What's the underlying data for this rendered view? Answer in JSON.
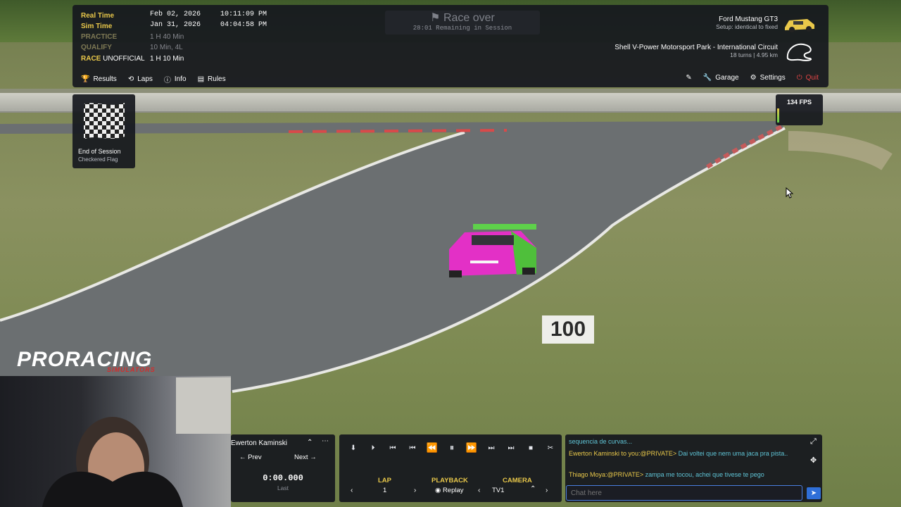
{
  "session": {
    "real_time_label": "Real Time",
    "real_time_date": "Feb 02, 2026",
    "real_time_clock": "10:11:09 PM",
    "sim_time_label": "Sim Time",
    "sim_time_date": "Jan 31, 2026",
    "sim_time_clock": "04:04:58 PM",
    "practice_label": "PRACTICE",
    "practice_value": "1 H 40 Min",
    "qualify_label": "QUALIFY",
    "qualify_value": "10 Min, 4L",
    "race_label": "RACE",
    "race_status": "UNOFFICIAL",
    "race_value": "1 H 10 Min"
  },
  "status": {
    "title": "Race over",
    "subtitle": "28:01 Remaining in Session"
  },
  "car": {
    "name": "Ford Mustang GT3",
    "setup": "Setup: identical to fixed"
  },
  "track": {
    "name": "Shell V-Power Motorsport Park - International Circuit",
    "details": "18 turns  |  4.95 km"
  },
  "tabs": {
    "results": "Results",
    "laps": "Laps",
    "info": "Info",
    "rules": "Rules"
  },
  "right_tabs": {
    "garage": "Garage",
    "settings": "Settings",
    "quit": "Quit"
  },
  "flag": {
    "title": "End of Session",
    "subtitle": "Checkered Flag"
  },
  "fps": "134  FPS",
  "trackside_sign": "100",
  "logo": {
    "main": "PRORACING",
    "sub": "SIMULATORS"
  },
  "driver_panel": {
    "name": "Ewerton Kaminski",
    "prev": "Prev",
    "next": "Next",
    "lap_time": "0:00.000",
    "lap_time_label": "Last"
  },
  "playback": {
    "lap_label": "LAP",
    "lap_value": "1",
    "playback_label": "PLAYBACK",
    "playback_value": "Replay",
    "camera_label": "CAMERA",
    "camera_value": "TV1"
  },
  "chat": {
    "messages": [
      {
        "who": "",
        "text": "sequencia de curvas..."
      },
      {
        "who": "Ewerton Kaminski to you:@PRIVATE>",
        "text": "Dai voltei que nem uma jaca pra pista.."
      },
      {
        "who": "Thiago Moya:@PRIVATE>",
        "text": "zampa me tocou, achei que tivese te pego"
      }
    ],
    "placeholder": "Chat here"
  },
  "colors": {
    "accent_yellow": "#e9c84a",
    "chat_cyan": "#5fc4d6",
    "quit_red": "#e24545",
    "focus_blue": "#4a7ee0"
  }
}
